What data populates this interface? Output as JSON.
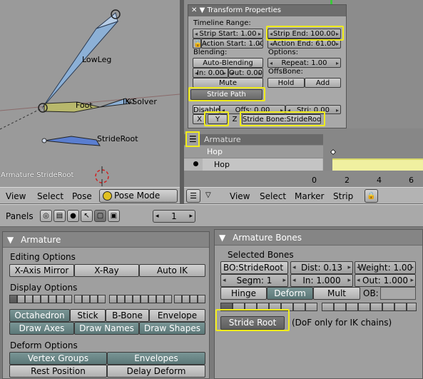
{
  "viewport": {
    "labels": {
      "lowleg": "LowLeg",
      "foot": "Foot",
      "iksolver": "IK-Solver",
      "strideroot": "StrideRoot"
    },
    "footer_text": "Armature StrideRoot",
    "menu": {
      "view": "View",
      "select": "Select",
      "pose": "Pose"
    },
    "mode": "Pose Mode"
  },
  "transform": {
    "title": "Transform Properties",
    "timeline_range": "Timeline Range:",
    "strip_start": "Strip Start: 1.00",
    "strip_end": "Strip End: 100.00",
    "action_start": "Action Start: 1.00",
    "action_end": "Action End: 61.00",
    "blending": "Blending:",
    "auto_blending": "Auto-Blending",
    "in": "In: 0.00",
    "out": "Out: 0.00",
    "mute": "Mute",
    "options": "Options:",
    "repeat": "Repeat: 1.00",
    "offsbone": "OffsBone:",
    "hold": "Hold",
    "add": "Add",
    "stride_path": "Stride Path",
    "disable": "Disable",
    "offs": "Offs: 0.00",
    "stri": "Stri: 0.00",
    "x": "X",
    "y": "Y",
    "z": "Z",
    "stride_bone": "Stride Bone:StrideRoot"
  },
  "timeline": {
    "channel_armature": "Armature",
    "channel_hop1": "Hop",
    "channel_hop2": "Hop",
    "ticks": [
      "0",
      "2",
      "4",
      "6"
    ],
    "menu": {
      "view": "View",
      "select": "Select",
      "marker": "Marker",
      "strip": "Strip"
    }
  },
  "buttons_header": {
    "panels": "Panels",
    "frame": "1"
  },
  "armature_panel": {
    "title": "Armature",
    "editing_options": "Editing Options",
    "x_axis_mirror": "X-Axis Mirror",
    "x_ray": "X-Ray",
    "auto_ik": "Auto IK",
    "display_options": "Display Options",
    "octahedron": "Octahedron",
    "stick": "Stick",
    "b_bone": "B-Bone",
    "envelope": "Envelope",
    "draw_axes": "Draw Axes",
    "draw_names": "Draw Names",
    "draw_shapes": "Draw Shapes",
    "deform_options": "Deform Options",
    "vertex_groups": "Vertex Groups",
    "envelopes": "Envelopes",
    "rest_position": "Rest Position",
    "delay_deform": "Delay Deform"
  },
  "bones_panel": {
    "title": "Armature Bones",
    "selected_bones": "Selected Bones",
    "bo": "BO:StrideRoot",
    "dist": "Dist: 0.13",
    "weight": "Weight: 1.00",
    "segm": "Segm: 1",
    "in": "In: 1.000",
    "out": "Out: 1.000",
    "hinge": "Hinge",
    "deform": "Deform",
    "mult": "Mult",
    "ob": "OB:",
    "stride_root": "Stride Root",
    "dof_note": "(DoF only for IK chains)"
  },
  "colors": {
    "highlight": "#f0ec1a",
    "bone_blue": "#7aa0c8",
    "foot_yellow": "#c8c86a",
    "time_line": "#3cc83c"
  }
}
